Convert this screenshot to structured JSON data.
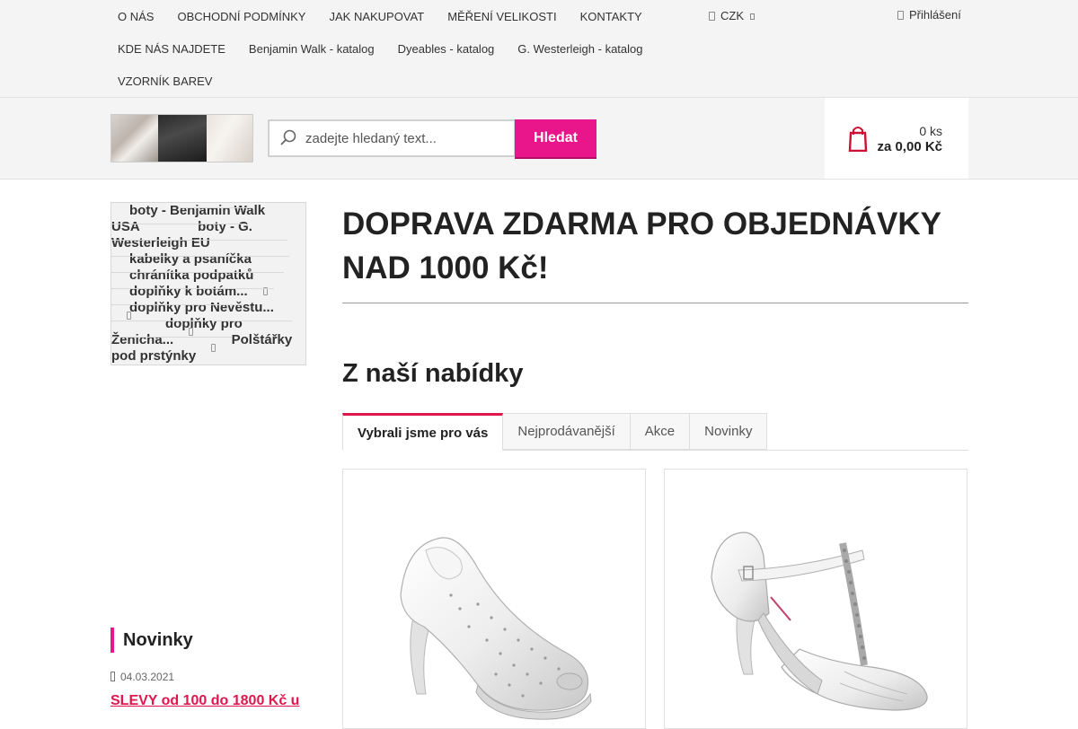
{
  "topnav": {
    "row1": [
      "O NÁS",
      "OBCHODNÍ PODMÍNKY",
      "JAK NAKUPOVAT",
      "MĚŘENÍ VELIKOSTI",
      "KONTAKTY"
    ],
    "row2": [
      "KDE NÁS NAJDETE",
      "Benjamin Walk - katalog",
      "Dyeables - katalog",
      "G. Westerleigh - katalog"
    ],
    "row3": [
      "VZORNÍK BAREV"
    ],
    "currency": "CZK",
    "login": "Přihlášení"
  },
  "search": {
    "placeholder": "zadejte hledaný text...",
    "button": "Hledat"
  },
  "cart": {
    "count": "0 ks",
    "total": "za 0,00 Kč"
  },
  "sidebar": {
    "categories": [
      {
        "label": "boty - Benjamin Walk USA",
        "has_sub": false
      },
      {
        "label": "boty - G. Westerleigh EU",
        "has_sub": false
      },
      {
        "label": "kabelky a psaníčka",
        "has_sub": false
      },
      {
        "label": "chránítka podpatků",
        "has_sub": false
      },
      {
        "label": "doplňky k botám...",
        "has_sub": true
      },
      {
        "label": "doplňky pro Nevěstu...",
        "has_sub": true
      },
      {
        "label": "doplňky pro Ženicha...",
        "has_sub": true
      },
      {
        "label": "Polštářky pod prstýnky",
        "has_sub": true
      }
    ],
    "news": {
      "title": "Novinky",
      "date": "04.03.2021",
      "link": "SLEVY od 100 do 1800 Kč u"
    }
  },
  "main": {
    "promo": "DOPRAVA ZDARMA PRO OBJEDNÁVKY NAD 1000 Kč!",
    "offer_title": "Z naší nabídky",
    "tabs": [
      "Vybrali jsme pro vás",
      "Nejprodávanější",
      "Akce",
      "Novinky"
    ],
    "active_tab": 0
  },
  "colors": {
    "accent": "#e8168a",
    "link": "#e0174d",
    "cart_icon": "#cc1133"
  }
}
